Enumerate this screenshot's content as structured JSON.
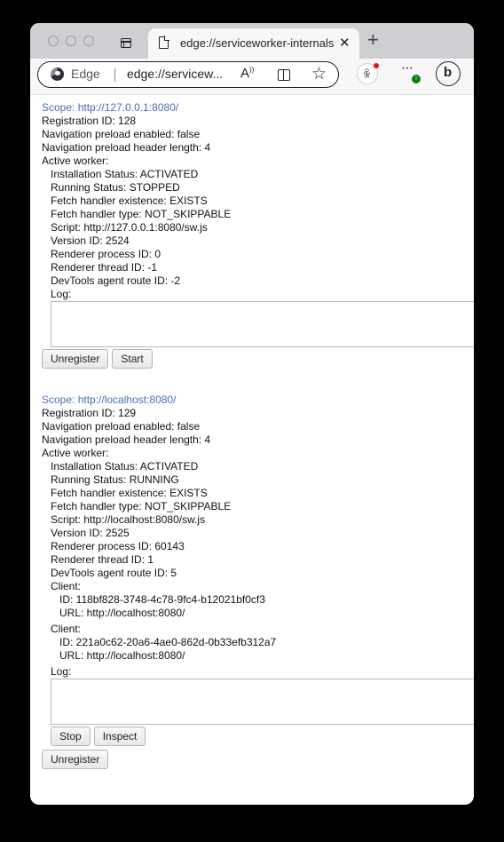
{
  "browser": {
    "tab_title": "edge://serviceworker-internals",
    "close_glyph": "✕",
    "new_tab_glyph": "+",
    "brand_label": "Edge",
    "url_display": "edge://servicew...",
    "read_aloud_glyph": "A",
    "favorite_glyph": "☆",
    "more_glyph": "···",
    "update_badge": "↑",
    "profile_glyph": "&",
    "copilot_glyph": "b",
    "icons": {
      "tab_actions": "tab-actions-icon",
      "page": "page-icon",
      "edge_logo": "edge-logo-icon",
      "read_aloud": "read-aloud-icon",
      "split_screen": "split-screen-icon",
      "favorites": "star-icon",
      "profile": "profile-icon",
      "more": "more-icon",
      "copilot": "copilot-icon"
    }
  },
  "registrations": [
    {
      "scope": "Scope: http://127.0.0.1:8080/",
      "registration_id": "Registration ID: 128",
      "nav_preload_enabled": "Navigation preload enabled: false",
      "nav_preload_header_length": "Navigation preload header length: 4",
      "active_worker_label": "Active worker:",
      "worker": {
        "installation_status": "Installation Status: ACTIVATED",
        "running_status": "Running Status: STOPPED",
        "fetch_handler_existence": "Fetch handler existence: EXISTS",
        "fetch_handler_type": "Fetch handler type: NOT_SKIPPABLE",
        "script": "Script: http://127.0.0.1:8080/sw.js",
        "version_id": "Version ID: 2524",
        "renderer_process_id": "Renderer process ID: 0",
        "renderer_thread_id": "Renderer thread ID: -1",
        "devtools_route_id": "DevTools agent route ID: -2",
        "log_label": "Log:",
        "log_value": ""
      },
      "buttons": {
        "unregister": "Unregister",
        "start": "Start"
      }
    },
    {
      "scope": "Scope: http://localhost:8080/",
      "registration_id": "Registration ID: 129",
      "nav_preload_enabled": "Navigation preload enabled: false",
      "nav_preload_header_length": "Navigation preload header length: 4",
      "active_worker_label": "Active worker:",
      "worker": {
        "installation_status": "Installation Status: ACTIVATED",
        "running_status": "Running Status: RUNNING",
        "fetch_handler_existence": "Fetch handler existence: EXISTS",
        "fetch_handler_type": "Fetch handler type: NOT_SKIPPABLE",
        "script": "Script: http://localhost:8080/sw.js",
        "version_id": "Version ID: 2525",
        "renderer_process_id": "Renderer process ID: 60143",
        "renderer_thread_id": "Renderer thread ID: 1",
        "devtools_route_id": "DevTools agent route ID: 5",
        "clients": [
          {
            "label": "Client:",
            "id": "ID: 118bf828-3748-4c78-9fc4-b12021bf0cf3",
            "url": "URL: http://localhost:8080/"
          },
          {
            "label": "Client:",
            "id": "ID: 221a0c62-20a6-4ae0-862d-0b33efb312a7",
            "url": "URL: http://localhost:8080/"
          }
        ],
        "log_label": "Log:",
        "log_value": ""
      },
      "buttons": {
        "stop": "Stop",
        "inspect": "Inspect",
        "unregister": "Unregister"
      }
    }
  ],
  "colors": {
    "scope_link": "#4a6bc0",
    "notification_dot": "#e81123",
    "update_badge": "#107c10"
  }
}
